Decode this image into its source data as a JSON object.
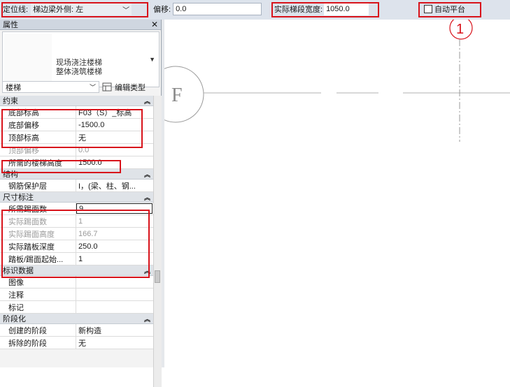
{
  "options_bar": {
    "location_line_label": "定位线:",
    "location_line_value": "梯边梁外侧: 左",
    "offset_label": "偏移:",
    "offset_value": "0.0",
    "actual_run_width_label": "实际梯段宽度:",
    "actual_run_width_value": "1050.0",
    "auto_landing_label": "自动平台",
    "auto_landing_checked": false
  },
  "properties": {
    "title": "属性",
    "type_name_line1": "现场浇注楼梯",
    "type_name_line2": "整体浇筑楼梯",
    "category": "楼梯",
    "edit_type_label": "编辑类型",
    "sections": [
      {
        "name": "约束",
        "rows": [
          {
            "key": "底部标高",
            "value": "F03（S）_标高",
            "dim": false
          },
          {
            "key": "底部偏移",
            "value": "-1500.0",
            "dim": false
          },
          {
            "key": "顶部标高",
            "value": "无",
            "dim": false
          },
          {
            "key": "顶部偏移",
            "value": "0.0",
            "dim": true
          },
          {
            "key": "所需的楼梯高度",
            "value": "1500.0",
            "dim": false
          }
        ]
      },
      {
        "name": "结构",
        "rows": [
          {
            "key": "钢筋保护层",
            "value": "I，(梁、柱、钢...",
            "dim": false
          }
        ]
      },
      {
        "name": "尺寸标注",
        "rows": [
          {
            "key": "所需踢面数",
            "value": "9",
            "dim": false,
            "edit": true
          },
          {
            "key": "实际踢面数",
            "value": "1",
            "dim": true
          },
          {
            "key": "实际踢面高度",
            "value": "166.7",
            "dim": true
          },
          {
            "key": "实际踏板深度",
            "value": "250.0",
            "dim": false
          },
          {
            "key": "踏板/踢面起始...",
            "value": "1",
            "dim": false
          }
        ]
      },
      {
        "name": "标识数据",
        "rows": [
          {
            "key": "图像",
            "value": "",
            "dim": false
          },
          {
            "key": "注释",
            "value": "",
            "dim": false
          },
          {
            "key": "标记",
            "value": "",
            "dim": false
          }
        ]
      },
      {
        "name": "阶段化",
        "rows": [
          {
            "key": "创建的阶段",
            "value": "新构造",
            "dim": false
          },
          {
            "key": "拆除的阶段",
            "value": "无",
            "dim": false
          }
        ]
      }
    ]
  },
  "drawing": {
    "grid_bubble_left": "F",
    "grid_bubble_top": "1"
  }
}
